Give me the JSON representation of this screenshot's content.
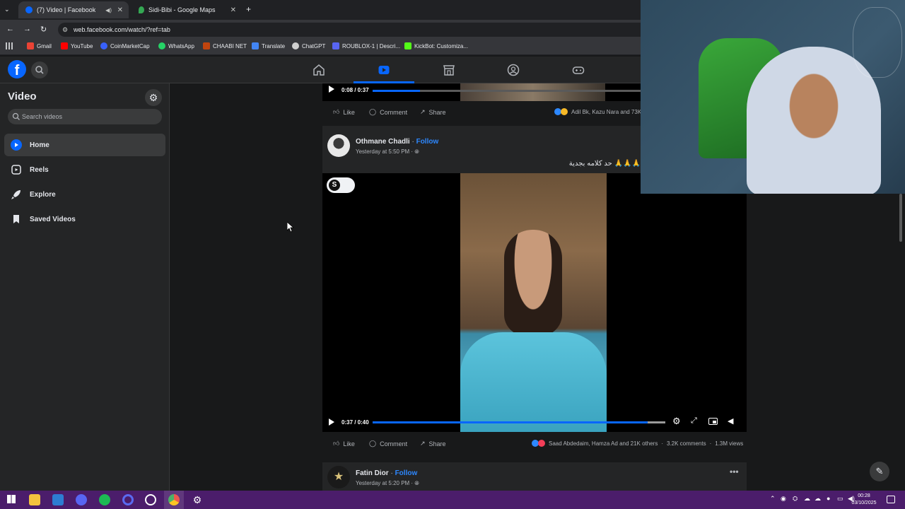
{
  "browser": {
    "tabs": [
      {
        "title": "(7) Video | Facebook",
        "active": true
      },
      {
        "title": "Sidi-Bibi - Google Maps",
        "active": false
      }
    ],
    "url": "web.facebook.com/watch/?ref=tab",
    "bookmarks": [
      {
        "label": "Gmail",
        "color": "#ea4335"
      },
      {
        "label": "YouTube",
        "color": "#ff0000"
      },
      {
        "label": "CoinMarketCap",
        "color": "#3861fb"
      },
      {
        "label": "WhatsApp",
        "color": "#25d366"
      },
      {
        "label": "CHAABI NET",
        "color": "#c1440e"
      },
      {
        "label": "Translate",
        "color": "#4285f4"
      },
      {
        "label": "ChatGPT",
        "color": "#cfcfcf"
      },
      {
        "label": "ROUBLOX-1 | Descri...",
        "color": "#5865f2"
      },
      {
        "label": "KickBot: Customiza...",
        "color": "#53fc18"
      }
    ]
  },
  "sidebar": {
    "title": "Video",
    "search_placeholder": "Search videos",
    "items": [
      {
        "label": "Home",
        "icon": "play-square-icon",
        "selected": true
      },
      {
        "label": "Reels",
        "icon": "reels-icon",
        "selected": false
      },
      {
        "label": "Explore",
        "icon": "rocket-icon",
        "selected": false
      },
      {
        "label": "Saved Videos",
        "icon": "bookmark-icon",
        "selected": false
      }
    ]
  },
  "post1": {
    "time": "0:08 / 0:37",
    "progress": 0.16,
    "actions": {
      "like": "Like",
      "comment": "Comment",
      "share": "Share"
    },
    "reactions": "Adil Bk, Kazu Nara and 73K"
  },
  "post2": {
    "author": "Othmane Chadli",
    "follow": "Follow",
    "sep": "·",
    "time": "Yesterday at 5:50 PM ·",
    "caption": "🙏🙏🙏 حد كلامه بجدية",
    "badge": "S",
    "video_time": "0:37 / 0:40",
    "progress": 0.94,
    "actions": {
      "like": "Like",
      "comment": "Comment",
      "share": "Share"
    },
    "reactions": "Saad Abdedaim, Hamza Ad and 21K others",
    "comments": "3.2K comments",
    "views": "1.3M views",
    "dot": "·"
  },
  "post3": {
    "author": "Fatin Dior",
    "follow": "Follow",
    "sep": "·",
    "time": "Yesterday at 5:20 PM ·"
  },
  "taskbar": {
    "time": "00:28",
    "date": "03/10/2025"
  },
  "colors": {
    "fb_blue": "#0866ff",
    "accent": "#2d88ff"
  }
}
